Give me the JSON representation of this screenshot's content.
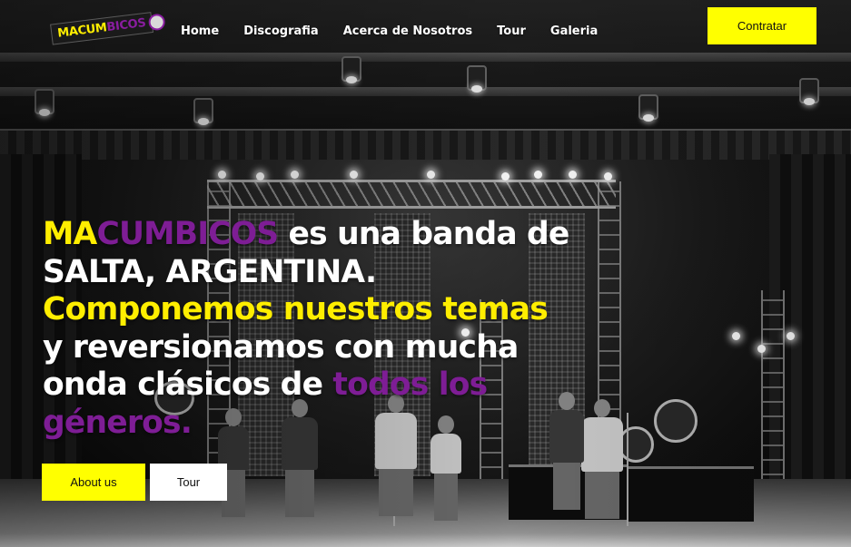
{
  "header": {
    "logo": {
      "part1": "MACUM",
      "part2": "BICOS"
    },
    "nav": [
      {
        "label": "Home"
      },
      {
        "label": "Discografia"
      },
      {
        "label": "Acerca de Nosotros"
      },
      {
        "label": "Tour"
      },
      {
        "label": "Galeria"
      }
    ],
    "cta_label": "Contratar"
  },
  "hero": {
    "brand_a": "MA",
    "brand_b": "CUMBICOS",
    "line1_rest": " es una banda de",
    "line2": "SALTA, ARGENTINA.",
    "line3": "Componemos nuestros temas",
    "line4": "y reversionamos con mucha",
    "line5_a": "onda clásicos de ",
    "line5_b": "todos los",
    "line6": "géneros."
  },
  "buttons": {
    "about_label": "About us",
    "tour_label": "Tour"
  },
  "colors": {
    "accent_yellow": "#ffff00",
    "accent_purple": "#7e1d95",
    "text_white": "#ffffff"
  }
}
